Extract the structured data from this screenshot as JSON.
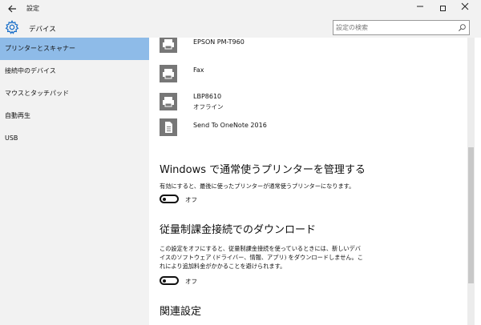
{
  "window": {
    "title": "設定",
    "back_icon": "arrow-left-icon",
    "minimize_icon": "minimize-icon",
    "maximize_icon": "maximize-icon",
    "close_icon": "close-icon"
  },
  "header": {
    "icon": "gear-icon",
    "title": "デバイス",
    "search_placeholder": "設定の検索",
    "search_icon": "search-icon"
  },
  "sidebar": {
    "items": [
      {
        "label": "プリンターとスキャナー",
        "selected": true
      },
      {
        "label": "接続中のデバイス",
        "selected": false
      },
      {
        "label": "マウスとタッチパッド",
        "selected": false
      },
      {
        "label": "自動再生",
        "selected": false
      },
      {
        "label": "USB",
        "selected": false
      }
    ]
  },
  "devices": [
    {
      "name": "EPSON PM-T960",
      "status": "",
      "icon": "printer-icon"
    },
    {
      "name": "Fax",
      "status": "",
      "icon": "printer-icon"
    },
    {
      "name": "LBP8610",
      "status": "オフライン",
      "icon": "printer-icon"
    },
    {
      "name": "Send To OneNote 2016",
      "status": "",
      "icon": "document-printer-icon"
    }
  ],
  "sections": {
    "manage_default": {
      "title": "Windows で通常使うプリンターを管理する",
      "description": "有効にすると、最後に使ったプリンターが通常使うプリンターになります。",
      "toggle_state": "オフ"
    },
    "metered_download": {
      "title": "従量制課金接続でのダウンロード",
      "description": "この設定をオフにすると、従量制課金接続を使っているときには、新しいデバイスのソフトウェア (ドライバー、情報、アプリ) をダウンロードしません。これにより追加料金がかかることを避けられます。",
      "toggle_state": "オフ"
    },
    "related": {
      "title": "関連設定"
    }
  },
  "colors": {
    "chrome_bg": "#f2f2f2",
    "selected_bg": "#8ebbe8",
    "device_icon": "#777777"
  }
}
